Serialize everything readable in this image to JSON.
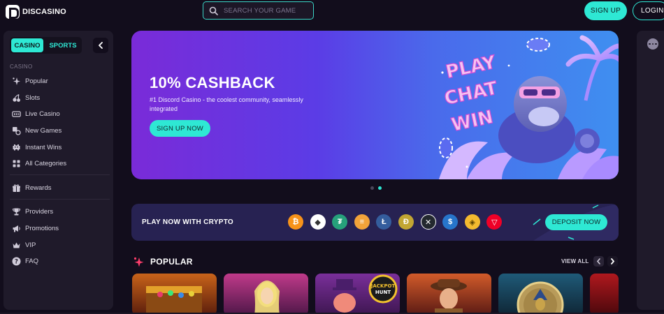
{
  "header": {
    "logo_text": "DISCASINO",
    "search_placeholder": "SEARCH YOUR GAME",
    "signup_label": "SIGN UP",
    "login_label": "LOGIN"
  },
  "sidebar": {
    "toggle": {
      "casino": "CASINO",
      "sports": "SPORTS"
    },
    "section_label": "CASINO",
    "items": [
      {
        "label": "Popular",
        "icon": "sparkle-icon"
      },
      {
        "label": "Slots",
        "icon": "cherries-icon"
      },
      {
        "label": "Live Casino",
        "icon": "live-icon"
      },
      {
        "label": "New Games",
        "icon": "new-games-icon"
      },
      {
        "label": "Instant Wins",
        "icon": "space-invader-icon"
      },
      {
        "label": "All Categories",
        "icon": "grid-icon"
      }
    ],
    "items2": [
      {
        "label": "Rewards",
        "icon": "gift-icon"
      }
    ],
    "items3": [
      {
        "label": "Providers",
        "icon": "trophy-icon"
      },
      {
        "label": "Promotions",
        "icon": "megaphone-icon"
      },
      {
        "label": "VIP",
        "icon": "crown-icon"
      },
      {
        "label": "FAQ",
        "icon": "question-icon"
      }
    ]
  },
  "hero": {
    "title": "10% CASHBACK",
    "subtitle": "#1 Discord Casino - the coolest community, seamlessly integrated",
    "button": "SIGN UP NOW",
    "art_words": [
      "PLAY",
      "CHAT",
      "WIN"
    ],
    "slides": 2,
    "active_slide": 2
  },
  "crypto": {
    "label": "PLAY NOW WITH CRYPTO",
    "coins": [
      {
        "name": "bitcoin-icon",
        "glyph": "₿",
        "color": "#f7931a"
      },
      {
        "name": "ethereum-icon",
        "glyph": "◆",
        "color": "#ffffff"
      },
      {
        "name": "tether-icon",
        "glyph": "₮",
        "color": "#26a17b"
      },
      {
        "name": "bitcoin-cash-icon",
        "glyph": "≡",
        "color": "#f2a33a"
      },
      {
        "name": "litecoin-icon",
        "glyph": "Ł",
        "color": "#345d9d"
      },
      {
        "name": "dogecoin-icon",
        "glyph": "Ð",
        "color": "#c2a633"
      },
      {
        "name": "xrp-icon",
        "glyph": "✕",
        "color": "#23292f"
      },
      {
        "name": "usd-coin-icon",
        "glyph": "$",
        "color": "#2775ca"
      },
      {
        "name": "binance-icon",
        "glyph": "◈",
        "color": "#f3ba2f"
      },
      {
        "name": "tron-icon",
        "glyph": "▽",
        "color": "#ef0027"
      }
    ],
    "deposit_label": "DEPOSIT NOW"
  },
  "popular": {
    "title": "POPULAR",
    "view_all": "VIEW ALL",
    "games": [
      {
        "name": "game-card-treasure-chest",
        "color_a": "#c8631a",
        "color_b": "#5a1d0c"
      },
      {
        "name": "game-card-lucky-lady",
        "color_a": "#c03a8a",
        "color_b": "#4e1748"
      },
      {
        "name": "game-card-jackpot-hunt",
        "color_a": "#7a2f9a",
        "color_b": "#3d1650",
        "badge": "JACKPOT HUNT"
      },
      {
        "name": "game-card-book-of-ra",
        "color_a": "#d25b2a",
        "color_b": "#5a1a14"
      },
      {
        "name": "game-card-pharaoh-coin",
        "color_a": "#1f5a78",
        "color_b": "#0f2635"
      },
      {
        "name": "game-card-partial",
        "color_a": "#b0181e",
        "color_b": "#4a080c"
      }
    ]
  },
  "colors": {
    "accent": "#2ee8d4",
    "background": "#120d1c",
    "panel": "#1f1a2a"
  }
}
